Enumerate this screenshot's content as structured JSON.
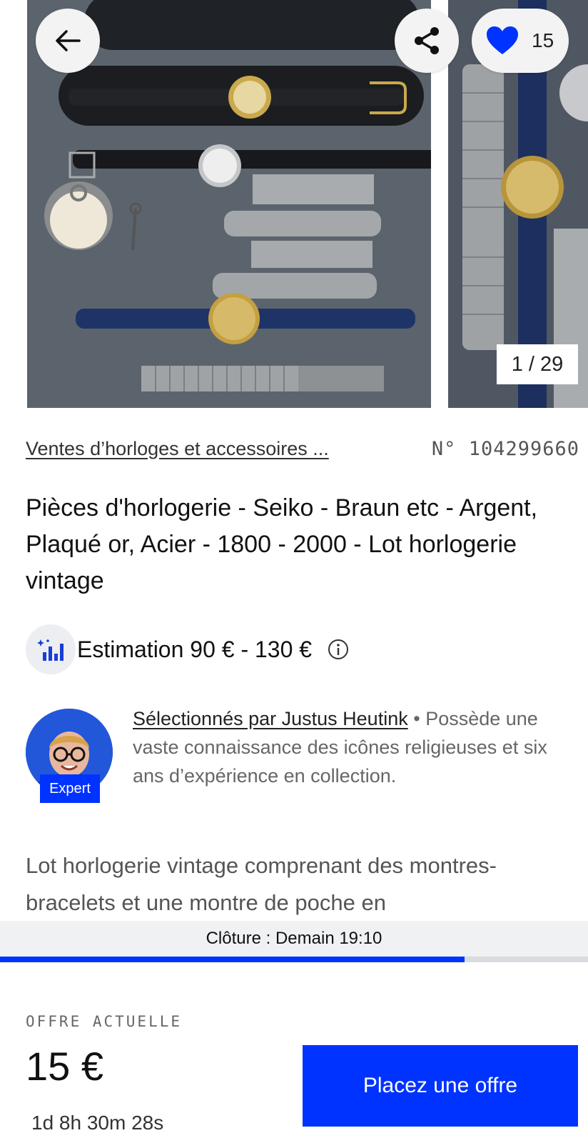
{
  "gallery": {
    "favorite_count": "15",
    "counter": "1 / 29",
    "icons": {
      "back": "arrow-left-icon",
      "share": "share-icon",
      "favorite": "heart-icon"
    },
    "colors": {
      "heart": "#0033ff"
    }
  },
  "lot": {
    "category": "Ventes d’horloges et accessoires ...",
    "number": "N° 104299660",
    "title": "Pièces d'horlogerie - Seiko - Braun etc - Argent, Plaqué or, Acier - 1800 - 2000 - Lot horlogerie vintage"
  },
  "estimate": {
    "text": "Estimation 90 € - 130 €",
    "icon": "chart-sparkle-icon"
  },
  "expert": {
    "name_link": "Sélectionnés par Justus Heutink",
    "separator": " • ",
    "bio": "Possède une vaste connaissance des icônes religieuses et six ans d’expérience en collection.",
    "badge": "Expert"
  },
  "description": "Lot horlogerie vintage comprenant des montres-bracelets et une montre de poche en",
  "closing": {
    "text": "Clôture : Demain 19:10",
    "progress_fraction": 0.79
  },
  "bid": {
    "label": "OFFRE ACTUELLE",
    "amount": "15 €",
    "countdown": "1d 8h 30m 28s",
    "button": "Placez une offre"
  },
  "colors": {
    "accent": "#0033ff",
    "closing_bg": "#f0f1f3"
  }
}
